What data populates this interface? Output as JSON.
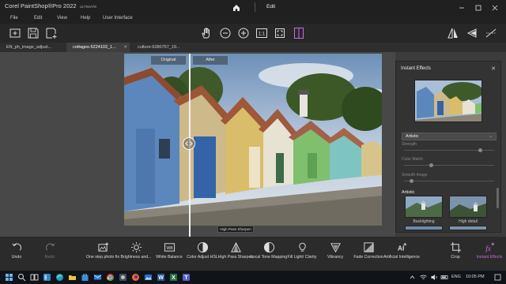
{
  "titlebar": {
    "app_name": "Corel",
    "product": "PaintShop®Pro 2022",
    "edition": "ULTIMATE",
    "active_tab": "Edit",
    "home_icon": "home-icon"
  },
  "menu": [
    "File",
    "Edit",
    "View",
    "Help",
    "User Interface"
  ],
  "toolbar_icons": [
    "new-file-icon",
    "save-icon",
    "save-as-icon",
    "pan-hand-icon",
    "zoom-out-icon",
    "zoom-in-icon",
    "actual-size-icon",
    "fit-to-window-icon",
    "compare-split-icon",
    "flip-icon",
    "rotate-icon",
    "straighten-icon"
  ],
  "tabs": [
    {
      "label": "EN_ph_image_adjust...",
      "active": false
    },
    {
      "label": "cottages-5224102_1...",
      "active": true
    },
    {
      "label": "culture-6380757_19...",
      "active": false
    }
  ],
  "canvas": {
    "original_label": "Original",
    "after_label": "After",
    "tooltip": "High Pass Sharpen"
  },
  "panel": {
    "title": "Instant Effects",
    "category": "Artistic",
    "sliders": [
      {
        "label": "Strength",
        "value": 0.85
      },
      {
        "label": "Color Match",
        "value": 0.3
      },
      {
        "label": "Smooth Image",
        "value": 0.08
      }
    ],
    "section": "Artistic",
    "effects": [
      {
        "label": "Backlighting"
      },
      {
        "label": "High detail"
      }
    ]
  },
  "adjust_tools": [
    {
      "label": "Undo",
      "icon": "undo-icon",
      "enabled": true
    },
    {
      "label": "Redo",
      "icon": "redo-icon",
      "enabled": false
    },
    {
      "label": "One step photo fix",
      "icon": "one-step-fix-icon",
      "enabled": true
    },
    {
      "label": "Brightness and...",
      "icon": "brightness-icon",
      "enabled": true
    },
    {
      "label": "White Balance",
      "icon": "white-balance-icon",
      "enabled": true
    },
    {
      "label": "Color Adjust HSL",
      "icon": "color-adjust-icon",
      "enabled": true
    },
    {
      "label": "High Pass Sharpen",
      "icon": "sharpen-icon",
      "enabled": true
    },
    {
      "label": "Local Tone Mapping",
      "icon": "tone-mapping-icon",
      "enabled": true
    },
    {
      "label": "Fill Light/ Clarity",
      "icon": "fill-light-icon",
      "enabled": true
    },
    {
      "label": "Vibrancy",
      "icon": "vibrancy-icon",
      "enabled": true
    },
    {
      "label": "Fade Correction",
      "icon": "fade-correction-icon",
      "enabled": true
    },
    {
      "label": "Artificial Intelligence",
      "icon": "ai-icon",
      "enabled": true
    },
    {
      "label": "Crop",
      "icon": "crop-icon",
      "enabled": true
    },
    {
      "label": "Instant Effects",
      "icon": "instant-effects-icon",
      "enabled": true,
      "selected": true
    }
  ],
  "taskbar": {
    "language": "ENG",
    "time": "10:05 PM",
    "icons": [
      "windows-start-icon",
      "search-icon",
      "task-view-icon",
      "widgets-icon",
      "edge-icon",
      "file-explorer-icon",
      "store-icon",
      "mail-icon",
      "chrome-icon",
      "paintshop-icon",
      "firefox-icon",
      "photos-icon",
      "word-icon",
      "excel-icon",
      "teams-icon"
    ]
  },
  "colors": {
    "accent": "#c66ce0",
    "titlebar": "#202020",
    "panel": "#333333"
  }
}
